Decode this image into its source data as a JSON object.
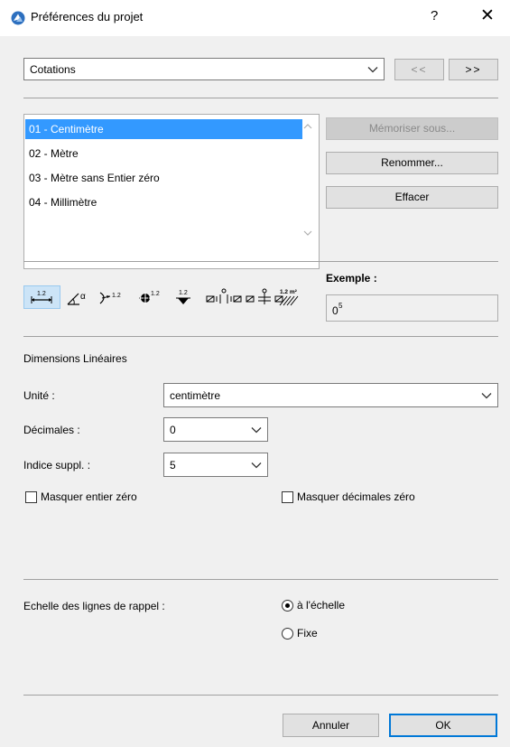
{
  "window": {
    "title": "Préférences du projet",
    "help_label": "?",
    "close_label": "✕"
  },
  "top": {
    "category_value": "Cotations",
    "prev_label": "<<",
    "next_label": ">>"
  },
  "presets": {
    "items": [
      {
        "label": "01 - Centimètre",
        "selected": true
      },
      {
        "label": "02 - Mètre",
        "selected": false
      },
      {
        "label": "03 - Mètre sans Entier zéro",
        "selected": false
      },
      {
        "label": "04 - Millimètre",
        "selected": false
      }
    ],
    "save_as_label": "Mémoriser sous...",
    "rename_label": "Renommer...",
    "delete_label": "Effacer"
  },
  "toolbar": {
    "icons": [
      "linear-dimension-icon",
      "angle-dimension-icon",
      "radial-dimension-icon",
      "level-dimension-icon",
      "elevation-dimension-icon",
      "door-window-dimension-icon",
      "sill-height-dimension-icon",
      "area-dimension-icon"
    ],
    "icon_labels": {
      "linear": "1.2",
      "angle": "α",
      "radial": "1.2",
      "level": "1.2",
      "elevation": "1.2",
      "area": "1.2 m²"
    }
  },
  "example": {
    "label": "Exemple :",
    "value": "0",
    "superscript": "5"
  },
  "linear": {
    "section_title": "Dimensions Linéaires",
    "unit_label": "Unité :",
    "unit_value": "centimètre",
    "decimals_label": "Décimales :",
    "decimals_value": "0",
    "extra_label": "Indice suppl. :",
    "extra_value": "5",
    "hide_zero_whole_label": "Masquer entier zéro",
    "hide_zero_whole_checked": false,
    "hide_zero_decimals_label": "Masquer décimales zéro",
    "hide_zero_decimals_checked": false
  },
  "scale": {
    "label": "Echelle des lignes de rappel :",
    "options": [
      {
        "label": "à l'échelle",
        "selected": true
      },
      {
        "label": "Fixe",
        "selected": false
      }
    ]
  },
  "footer": {
    "cancel_label": "Annuler",
    "ok_label": "OK"
  },
  "colors": {
    "selection": "#3399ff",
    "dialog_bg": "#f0f0f0",
    "ok_border": "#0078d7"
  }
}
